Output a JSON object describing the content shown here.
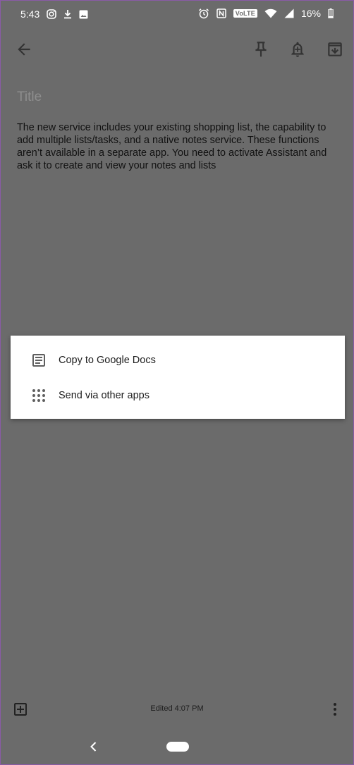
{
  "status_bar": {
    "time": "5:43",
    "network_label": "VoLTE",
    "battery": "16%"
  },
  "app_bar": {
    "back_icon": "arrow-back-icon",
    "pin_icon": "pin-icon",
    "reminder_icon": "reminder-bell-icon",
    "archive_icon": "archive-icon"
  },
  "note": {
    "title_placeholder": "Title",
    "body": "The new service includes your existing shopping list, the capability to add multiple lists/tasks, and a native notes service. These functions aren’t available in a separate app. You need to activate Assistant and ask it to create and view your notes and lists"
  },
  "menu": {
    "items": [
      {
        "label": "Copy to Google Docs",
        "icon": "document-icon"
      },
      {
        "label": "Send via other apps",
        "icon": "apps-grid-icon"
      }
    ]
  },
  "bottom_bar": {
    "edited": "Edited 4:07 PM"
  },
  "colors": {
    "scrim_background": "#6b6b6b",
    "menu_background": "#ffffff",
    "text_dark": "#202020",
    "frame_border": "#8a5aa8"
  }
}
